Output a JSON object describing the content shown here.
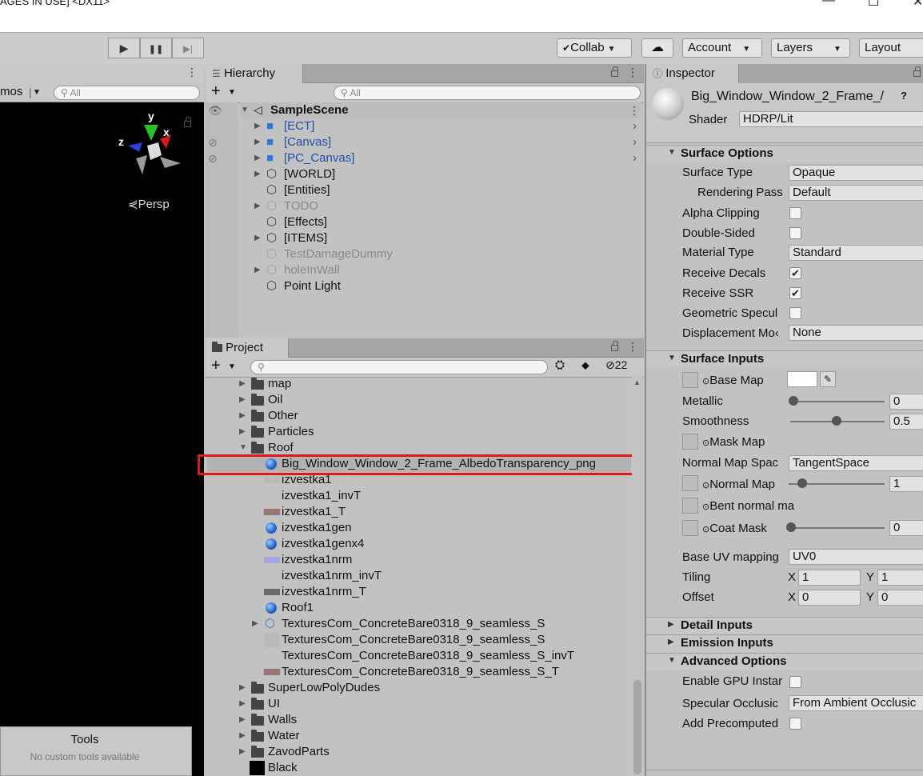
{
  "window": {
    "title": "AGES IN USE] <DX11>",
    "minimize": "—",
    "maximize": "☐",
    "close": "✕"
  },
  "toolbar": {
    "play_icon": "▶",
    "pause_icon": "❚❚",
    "step_icon": "▶|",
    "collab": "Collab",
    "collab_check": "✔",
    "cloud_icon": "☁",
    "account": "Account",
    "layers": "Layers",
    "layout": "Layout",
    "dropdown": "▼"
  },
  "scene": {
    "gizmos": "mos",
    "search_placeholder": "All",
    "persp": "Persp",
    "axis_y": "y",
    "axis_x": "x",
    "axis_z": "z",
    "tools_title": "Tools",
    "tools_subtitle": "No custom tools available"
  },
  "hierarchy": {
    "tab": "Hierarchy",
    "search_placeholder": "All",
    "scene_name": "SampleScene",
    "items": [
      {
        "label": "[ECT]",
        "color": "#1f4fa8",
        "arrow": true
      },
      {
        "label": "[Canvas]",
        "color": "#1f4fa8",
        "arrow": true
      },
      {
        "label": "[PC_Canvas]",
        "color": "#1f4fa8",
        "arrow": true
      },
      {
        "label": "[WORLD]",
        "color": "#111111",
        "arrow": true
      },
      {
        "label": "[Entities]",
        "color": "#111111",
        "arrow": false
      },
      {
        "label": "TODO",
        "color": "#8a8a8a",
        "arrow": true
      },
      {
        "label": "[Effects]",
        "color": "#111111",
        "arrow": false
      },
      {
        "label": "[ITEMS]",
        "color": "#111111",
        "arrow": true
      },
      {
        "label": "TestDamageDummy",
        "color": "#8a8a8a",
        "arrow": false
      },
      {
        "label": "holeInWall",
        "color": "#8a8a8a",
        "arrow": true
      },
      {
        "label": "Point Light",
        "color": "#111111",
        "arrow": false
      }
    ]
  },
  "project": {
    "tab": "Project",
    "hidden_count": "22",
    "rows": [
      {
        "label": "map",
        "type": "folder",
        "indent": 0,
        "arrow": "▶"
      },
      {
        "label": "Oil",
        "type": "folder",
        "indent": 0,
        "arrow": "▶"
      },
      {
        "label": "Other",
        "type": "folder",
        "indent": 0,
        "arrow": "▶"
      },
      {
        "label": "Particles",
        "type": "folder",
        "indent": 0,
        "arrow": "▶"
      },
      {
        "label": "Roof",
        "type": "folder",
        "indent": 0,
        "arrow": "▼"
      },
      {
        "label": "Big_Window_Window_2_Frame_AlbedoTransparency_png",
        "type": "material",
        "indent": 1,
        "arrow": ""
      },
      {
        "label": "izvestka1",
        "type": "texture",
        "indent": 1,
        "arrow": ""
      },
      {
        "label": "izvestka1_invT",
        "type": "none",
        "indent": 1,
        "arrow": ""
      },
      {
        "label": "izvestka1_T",
        "type": "texture-red",
        "indent": 1,
        "arrow": ""
      },
      {
        "label": "izvestka1gen",
        "type": "material",
        "indent": 1,
        "arrow": ""
      },
      {
        "label": "izvestka1genx4",
        "type": "material",
        "indent": 1,
        "arrow": ""
      },
      {
        "label": "izvestka1nrm",
        "type": "texture-blue",
        "indent": 1,
        "arrow": ""
      },
      {
        "label": "izvestka1nrm_invT",
        "type": "none",
        "indent": 1,
        "arrow": ""
      },
      {
        "label": "izvestka1nrm_T",
        "type": "texture-dark",
        "indent": 1,
        "arrow": ""
      },
      {
        "label": "Roof1",
        "type": "material",
        "indent": 1,
        "arrow": ""
      },
      {
        "label": "TexturesCom_ConcreteBare0318_9_seamless_S",
        "type": "prefab",
        "indent": 1,
        "arrow": "▶"
      },
      {
        "label": "TexturesCom_ConcreteBare0318_9_seamless_S",
        "type": "texture",
        "indent": 1,
        "arrow": ""
      },
      {
        "label": "TexturesCom_ConcreteBare0318_9_seamless_S_invT",
        "type": "none",
        "indent": 1,
        "arrow": ""
      },
      {
        "label": "TexturesCom_ConcreteBare0318_9_seamless_S_T",
        "type": "texture-red",
        "indent": 1,
        "arrow": ""
      },
      {
        "label": "SuperLowPolyDudes",
        "type": "folder",
        "indent": 0,
        "arrow": "▶"
      },
      {
        "label": "UI",
        "type": "folder",
        "indent": 0,
        "arrow": "▶"
      },
      {
        "label": "Walls",
        "type": "folder",
        "indent": 0,
        "arrow": "▶"
      },
      {
        "label": "Water",
        "type": "folder",
        "indent": 0,
        "arrow": "▶"
      },
      {
        "label": "ZavodParts",
        "type": "folder",
        "indent": 0,
        "arrow": "▶"
      },
      {
        "label": "Black",
        "type": "black",
        "indent": 0,
        "arrow": ""
      }
    ]
  },
  "inspector": {
    "tab": "Inspector",
    "material_name": "Big_Window_Window_2_Frame_/",
    "shader_label": "Shader",
    "shader_value": "HDRP/Lit",
    "surface_options": "Surface Options",
    "surface_type_label": "Surface Type",
    "surface_type_value": "Opaque",
    "rendering_pass_label": "Rendering Pass",
    "rendering_pass_value": "Default",
    "alpha_clipping": "Alpha Clipping",
    "double_sided": "Double-Sided",
    "material_type_label": "Material Type",
    "material_type_value": "Standard",
    "receive_decals": "Receive Decals",
    "receive_ssr": "Receive SSR",
    "geometric_specular": "Geometric Specul",
    "displacement_label": "Displacement Mo‹",
    "displacement_value": "None",
    "surface_inputs": "Surface Inputs",
    "base_map": "Base Map",
    "metallic": "Metallic",
    "metallic_value": "0",
    "smoothness": "Smoothness",
    "smoothness_value": "0.5",
    "mask_map": "Mask Map",
    "normal_map_space_label": "Normal Map Spac",
    "normal_map_space_value": "TangentSpace",
    "normal_map": "Normal Map",
    "normal_map_value": "1",
    "bent_normal": "Bent normal ma",
    "coat_mask": "Coat Mask",
    "coat_mask_value": "0",
    "base_uv_label": "Base UV mapping",
    "base_uv_value": "UV0",
    "tiling": "Tiling",
    "tiling_x": "1",
    "tiling_y": "1",
    "offset": "Offset",
    "offset_x": "0",
    "offset_y": "0",
    "x_label": "X",
    "y_label": "Y",
    "detail_inputs": "Detail Inputs",
    "emission_inputs": "Emission Inputs",
    "advanced_options": "Advanced Options",
    "enable_gpu": "Enable GPU Instar",
    "specular_occlusion_label": "Specular Occlusic",
    "specular_occlusion_value": "From Ambient Occlusic",
    "add_precomputed": "Add Precomputed",
    "check": "✔",
    "expand": "▶",
    "collapse": "▼"
  }
}
